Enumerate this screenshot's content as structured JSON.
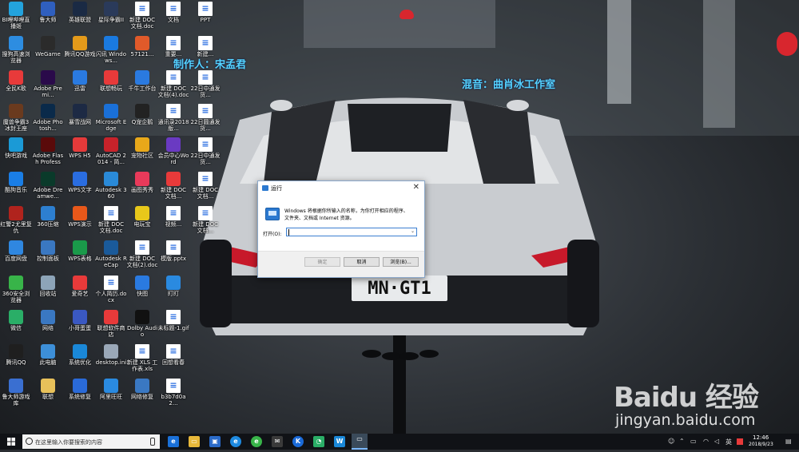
{
  "desktop": {
    "columns": [
      [
        {
          "label": "BI哩哔哩直播姬",
          "icon": "bilibili-icon",
          "color": "#23a3dd"
        },
        {
          "label": "搜狗高速浏览器",
          "icon": "sogou-browser-icon",
          "color": "#2d8de1"
        },
        {
          "label": "全民K歌",
          "icon": "karaoke-icon",
          "color": "#e83a3a"
        },
        {
          "label": "魔兽争霸3 冰封王座",
          "icon": "warcraft-icon",
          "color": "#6a3a1e"
        },
        {
          "label": "快吧游戏",
          "icon": "kuaiba-icon",
          "color": "#1b9ad6"
        },
        {
          "label": "酷狗音乐",
          "icon": "kugou-icon",
          "color": "#1a7ee6"
        },
        {
          "label": "红警2尤里复仇",
          "icon": "redalert-icon",
          "color": "#b0231d"
        },
        {
          "label": "百度网盘",
          "icon": "baidu-netdisk-icon",
          "color": "#2f87e0"
        },
        {
          "label": "360安全浏览器",
          "icon": "360-browser-icon",
          "color": "#38b449"
        },
        {
          "label": "微信",
          "icon": "wechat-icon",
          "color": "#2aae67"
        },
        {
          "label": "腾讯QQ",
          "icon": "qq-icon",
          "color": "#1f1f1f"
        },
        {
          "label": "鲁大师游戏库",
          "icon": "ludashi-games-icon",
          "color": "#3a6fd1"
        }
      ],
      [
        {
          "label": "鲁大师",
          "icon": "ludashi-icon",
          "color": "#2f5fbe"
        },
        {
          "label": "WeGame",
          "icon": "wegame-icon",
          "color": "#2b2b2b"
        },
        {
          "label": "Adobe Premi...",
          "icon": "premiere-icon",
          "color": "#2a0a4a"
        },
        {
          "label": "Adobe Photosh...",
          "icon": "photoshop-icon",
          "color": "#0a2a4a"
        },
        {
          "label": "Adobe Flash Professi...",
          "icon": "flash-icon",
          "color": "#5a0a0a"
        },
        {
          "label": "Adobe Dreamwe...",
          "icon": "dreamweaver-icon",
          "color": "#0a3a2a"
        },
        {
          "label": "360压缩",
          "icon": "360zip-icon",
          "color": "#2d7fd0"
        },
        {
          "label": "控制面板",
          "icon": "control-panel-icon",
          "color": "#3a78c2"
        },
        {
          "label": "回收站",
          "icon": "recycle-bin-icon",
          "color": "#8da4b8"
        },
        {
          "label": "网络",
          "icon": "network-icon",
          "color": "#3a78c2"
        },
        {
          "label": "此电脑",
          "icon": "this-pc-icon",
          "color": "#3d8fd8"
        },
        {
          "label": "联想",
          "icon": "lenovo-folder-icon",
          "color": "#e8c15a"
        }
      ],
      [
        {
          "label": "英雄联盟",
          "icon": "lol-icon",
          "color": "#1a2a44"
        },
        {
          "label": "腾讯QQ游戏",
          "icon": "qqgame-icon",
          "color": "#e49a1a"
        },
        {
          "label": "迅雷",
          "icon": "xunlei-icon",
          "color": "#2a7ae0"
        },
        {
          "label": "暴雪战网",
          "icon": "battlenet-icon",
          "color": "#1d2a44"
        },
        {
          "label": "WPS H5",
          "icon": "wps-h5-icon",
          "color": "#e53a3a"
        },
        {
          "label": "WPS文字",
          "icon": "wps-writer-icon",
          "color": "#2a6de0"
        },
        {
          "label": "WPS演示",
          "icon": "wps-presentation-icon",
          "color": "#e8581a"
        },
        {
          "label": "WPS表格",
          "icon": "wps-sheet-icon",
          "color": "#1a9a4a"
        },
        {
          "label": "爱奇艺",
          "icon": "iqiyi-icon",
          "color": "#e83a3a"
        },
        {
          "label": "小哥蛋蛋",
          "icon": "game-icon",
          "color": "#3a58c2"
        },
        {
          "label": "系统优化",
          "icon": "optimize-icon",
          "color": "#1a88d8"
        },
        {
          "label": "系统修复",
          "icon": "repair-icon",
          "color": "#2a6ad8"
        }
      ],
      [
        {
          "label": "星际争霸II",
          "icon": "starcraft-icon",
          "color": "#2a3a5a"
        },
        {
          "label": "闪讯 Windows...",
          "icon": "windows-icon",
          "color": "#1a7ae0"
        },
        {
          "label": "联想畅玩",
          "icon": "lenovo-play-icon",
          "color": "#e83a3a"
        },
        {
          "label": "Microsoft Edge",
          "icon": "edge-icon",
          "color": "#1a70d8"
        },
        {
          "label": "AutoCAD 2014 - 简...",
          "icon": "autocad-icon",
          "color": "#c8222a"
        },
        {
          "label": "Autodesk 360",
          "icon": "autodesk-icon",
          "color": "#2a8ad8"
        },
        {
          "label": "新建 DOC 文档.doc",
          "icon": "doc-file-icon",
          "color": "#ffffff"
        },
        {
          "label": "Autodesk ReCap",
          "icon": "recap-icon",
          "color": "#1a5a9a"
        },
        {
          "label": "个人简历.docx",
          "icon": "docx-file-icon",
          "color": "#ffffff"
        },
        {
          "label": "联想软件商店",
          "icon": "lenovo-store-icon",
          "color": "#e83a3a"
        },
        {
          "label": "desktop.ini",
          "icon": "ini-file-icon",
          "color": "#9aa8b8"
        },
        {
          "label": "阿里旺旺",
          "icon": "aliwangwang-icon",
          "color": "#2a8ae0"
        }
      ],
      [
        {
          "label": "新建 DOC 文档.doc",
          "icon": "doc-file-icon",
          "color": "#ffffff"
        },
        {
          "label": "57121...",
          "icon": "image-file-icon",
          "color": "#e05a2a"
        },
        {
          "label": "千牛工作台",
          "icon": "qianniu-icon",
          "color": "#2a7ae0"
        },
        {
          "label": "Q宠企鹅",
          "icon": "qq-pet-icon",
          "color": "#222222"
        },
        {
          "label": "宠物社区",
          "icon": "pet-community-icon",
          "color": "#e8a81a"
        },
        {
          "label": "画图秀秀",
          "icon": "paint-icon",
          "color": "#e83a5a"
        },
        {
          "label": "电玩宝",
          "icon": "game-box-icon",
          "color": "#e8c81a"
        },
        {
          "label": "新建 DOC 文档(2).doc",
          "icon": "doc-file-icon",
          "color": "#ffffff"
        },
        {
          "label": "快图",
          "icon": "photo-icon",
          "color": "#2a7ae0"
        },
        {
          "label": "Dolby Audio",
          "icon": "dolby-icon",
          "color": "#111111"
        },
        {
          "label": "新建 XLS 工作表.xls",
          "icon": "xls-file-icon",
          "color": "#ffffff"
        },
        {
          "label": "网络修复",
          "icon": "network-repair-icon",
          "color": "#3a78c2"
        }
      ],
      [
        {
          "label": "文档",
          "icon": "doc-file-icon",
          "color": "#ffffff"
        },
        {
          "label": "重要...",
          "icon": "doc-file-icon",
          "color": "#ffffff"
        },
        {
          "label": "新建 DOC 文档(4).doc",
          "icon": "doc-file-icon",
          "color": "#ffffff"
        },
        {
          "label": "通讯录2018版...",
          "icon": "doc-file-icon",
          "color": "#ffffff"
        },
        {
          "label": "会员中心Word",
          "icon": "word-icon",
          "color": "#6a3ac2"
        },
        {
          "label": "新建 DOC 文档...",
          "icon": "pdf-file-icon",
          "color": "#e83a3a"
        },
        {
          "label": "视频...",
          "icon": "pdf-file-icon",
          "color": "#ffffff"
        },
        {
          "label": "模版.pptx",
          "icon": "pptx-file-icon",
          "color": "#ffffff"
        },
        {
          "label": "盯盯",
          "icon": "dingding-icon",
          "color": "#2a8ae0"
        },
        {
          "label": "未标题-1.gif",
          "icon": "gif-file-icon",
          "color": "#ffffff"
        },
        {
          "label": "回想看春",
          "icon": "doc-file-icon",
          "color": "#ffffff"
        },
        {
          "label": "b3b7d0a2...",
          "icon": "image-file-icon",
          "color": "#ffffff"
        }
      ],
      [
        {
          "label": "PPT",
          "icon": "ppt-file-icon",
          "color": "#ffffff"
        },
        {
          "label": "新建...",
          "icon": "doc-file-icon",
          "color": "#ffffff"
        },
        {
          "label": "22日中通发货...",
          "icon": "xls-file-icon",
          "color": "#ffffff"
        },
        {
          "label": "22日圆通发货...",
          "icon": "xls-file-icon",
          "color": "#ffffff"
        },
        {
          "label": "22日中通发货...",
          "icon": "xls-file-icon",
          "color": "#ffffff"
        },
        {
          "label": "新建 DOC 文档...",
          "icon": "doc-file-icon",
          "color": "#ffffff"
        },
        {
          "label": "新建 DOC 文档...",
          "icon": "doc-file-icon",
          "color": "#ffffff"
        }
      ]
    ],
    "overlay_text": {
      "author": "制作人：宋孟君",
      "music": "混音：曲肖冰工作室"
    },
    "license_plate": "MN·GT1"
  },
  "run_dialog": {
    "title": "运行",
    "description_line1": "Windows 将根据你所输入的名称，为你打开相应的程序、",
    "description_line2": "文件夹、文档或 Internet 资源。",
    "open_label": "打开(O):",
    "input_value": "",
    "ok_label": "确定",
    "cancel_label": "取消",
    "browse_label": "浏览(B)...",
    "close_label": "✕"
  },
  "taskbar": {
    "search_placeholder": "在这里输入你要搜索的内容",
    "clock_time": "12:46",
    "clock_date": "2018/9/23",
    "tray_language": "英"
  },
  "watermark": {
    "logo_text": "Baidu 经验",
    "url": "jingyan.baidu.com"
  }
}
